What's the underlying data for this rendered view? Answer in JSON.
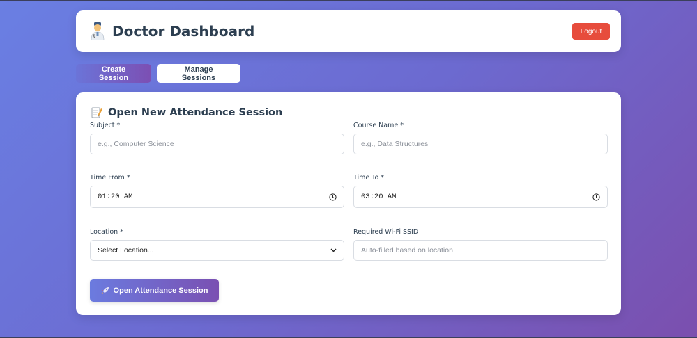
{
  "header": {
    "title": "Doctor Dashboard",
    "logout_label": "Logout"
  },
  "tabs": [
    {
      "label": "Create Session",
      "active": true
    },
    {
      "label": "Manage Sessions",
      "active": false
    }
  ],
  "form": {
    "title": "Open New Attendance Session",
    "subject": {
      "label": "Subject *",
      "placeholder": "e.g., Computer Science",
      "value": ""
    },
    "course": {
      "label": "Course Name *",
      "placeholder": "e.g., Data Structures",
      "value": ""
    },
    "time_from": {
      "label": "Time From *",
      "value": "01:20 AM"
    },
    "time_to": {
      "label": "Time To *",
      "value": "03:20 AM"
    },
    "location": {
      "label": "Location *",
      "value": "Select Location..."
    },
    "wifi": {
      "label": "Required Wi-Fi SSID",
      "placeholder": "Auto-filled based on location",
      "value": ""
    },
    "submit_label": "Open Attendance Session"
  },
  "colors": {
    "logout": "#e74c3c",
    "accent_start": "#6b7bdf",
    "accent_end": "#7a50b2",
    "text": "#2c3e50"
  }
}
